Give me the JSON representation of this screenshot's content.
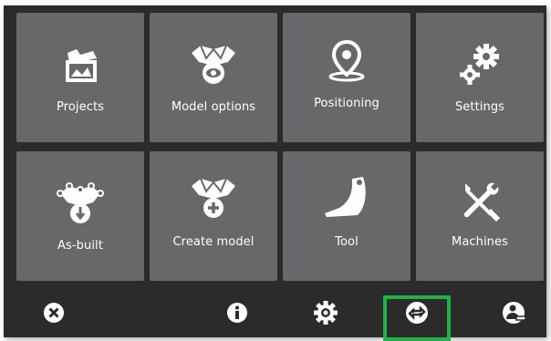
{
  "tiles": [
    {
      "label": "Projects",
      "icon": "projects-icon"
    },
    {
      "label": "Model options",
      "icon": "model-options-icon"
    },
    {
      "label": "Positioning",
      "icon": "location-pin-icon"
    },
    {
      "label": "Settings",
      "icon": "gears-icon"
    },
    {
      "label": "As-built",
      "icon": "as-built-icon"
    },
    {
      "label": "Create model",
      "icon": "create-model-icon"
    },
    {
      "label": "Tool",
      "icon": "bucket-icon"
    },
    {
      "label": "Machines",
      "icon": "wrench-screwdriver-icon"
    }
  ],
  "bottom_bar": {
    "buttons": [
      "close-icon",
      "info-icon",
      "settings-cog-icon",
      "sync-icon",
      "operator-icon"
    ],
    "highlighted": "sync-icon",
    "highlight_color": "#22b04a"
  },
  "colors": {
    "tile": "#68686a",
    "background": "#2b2b2b",
    "icon": "#ffffff"
  }
}
